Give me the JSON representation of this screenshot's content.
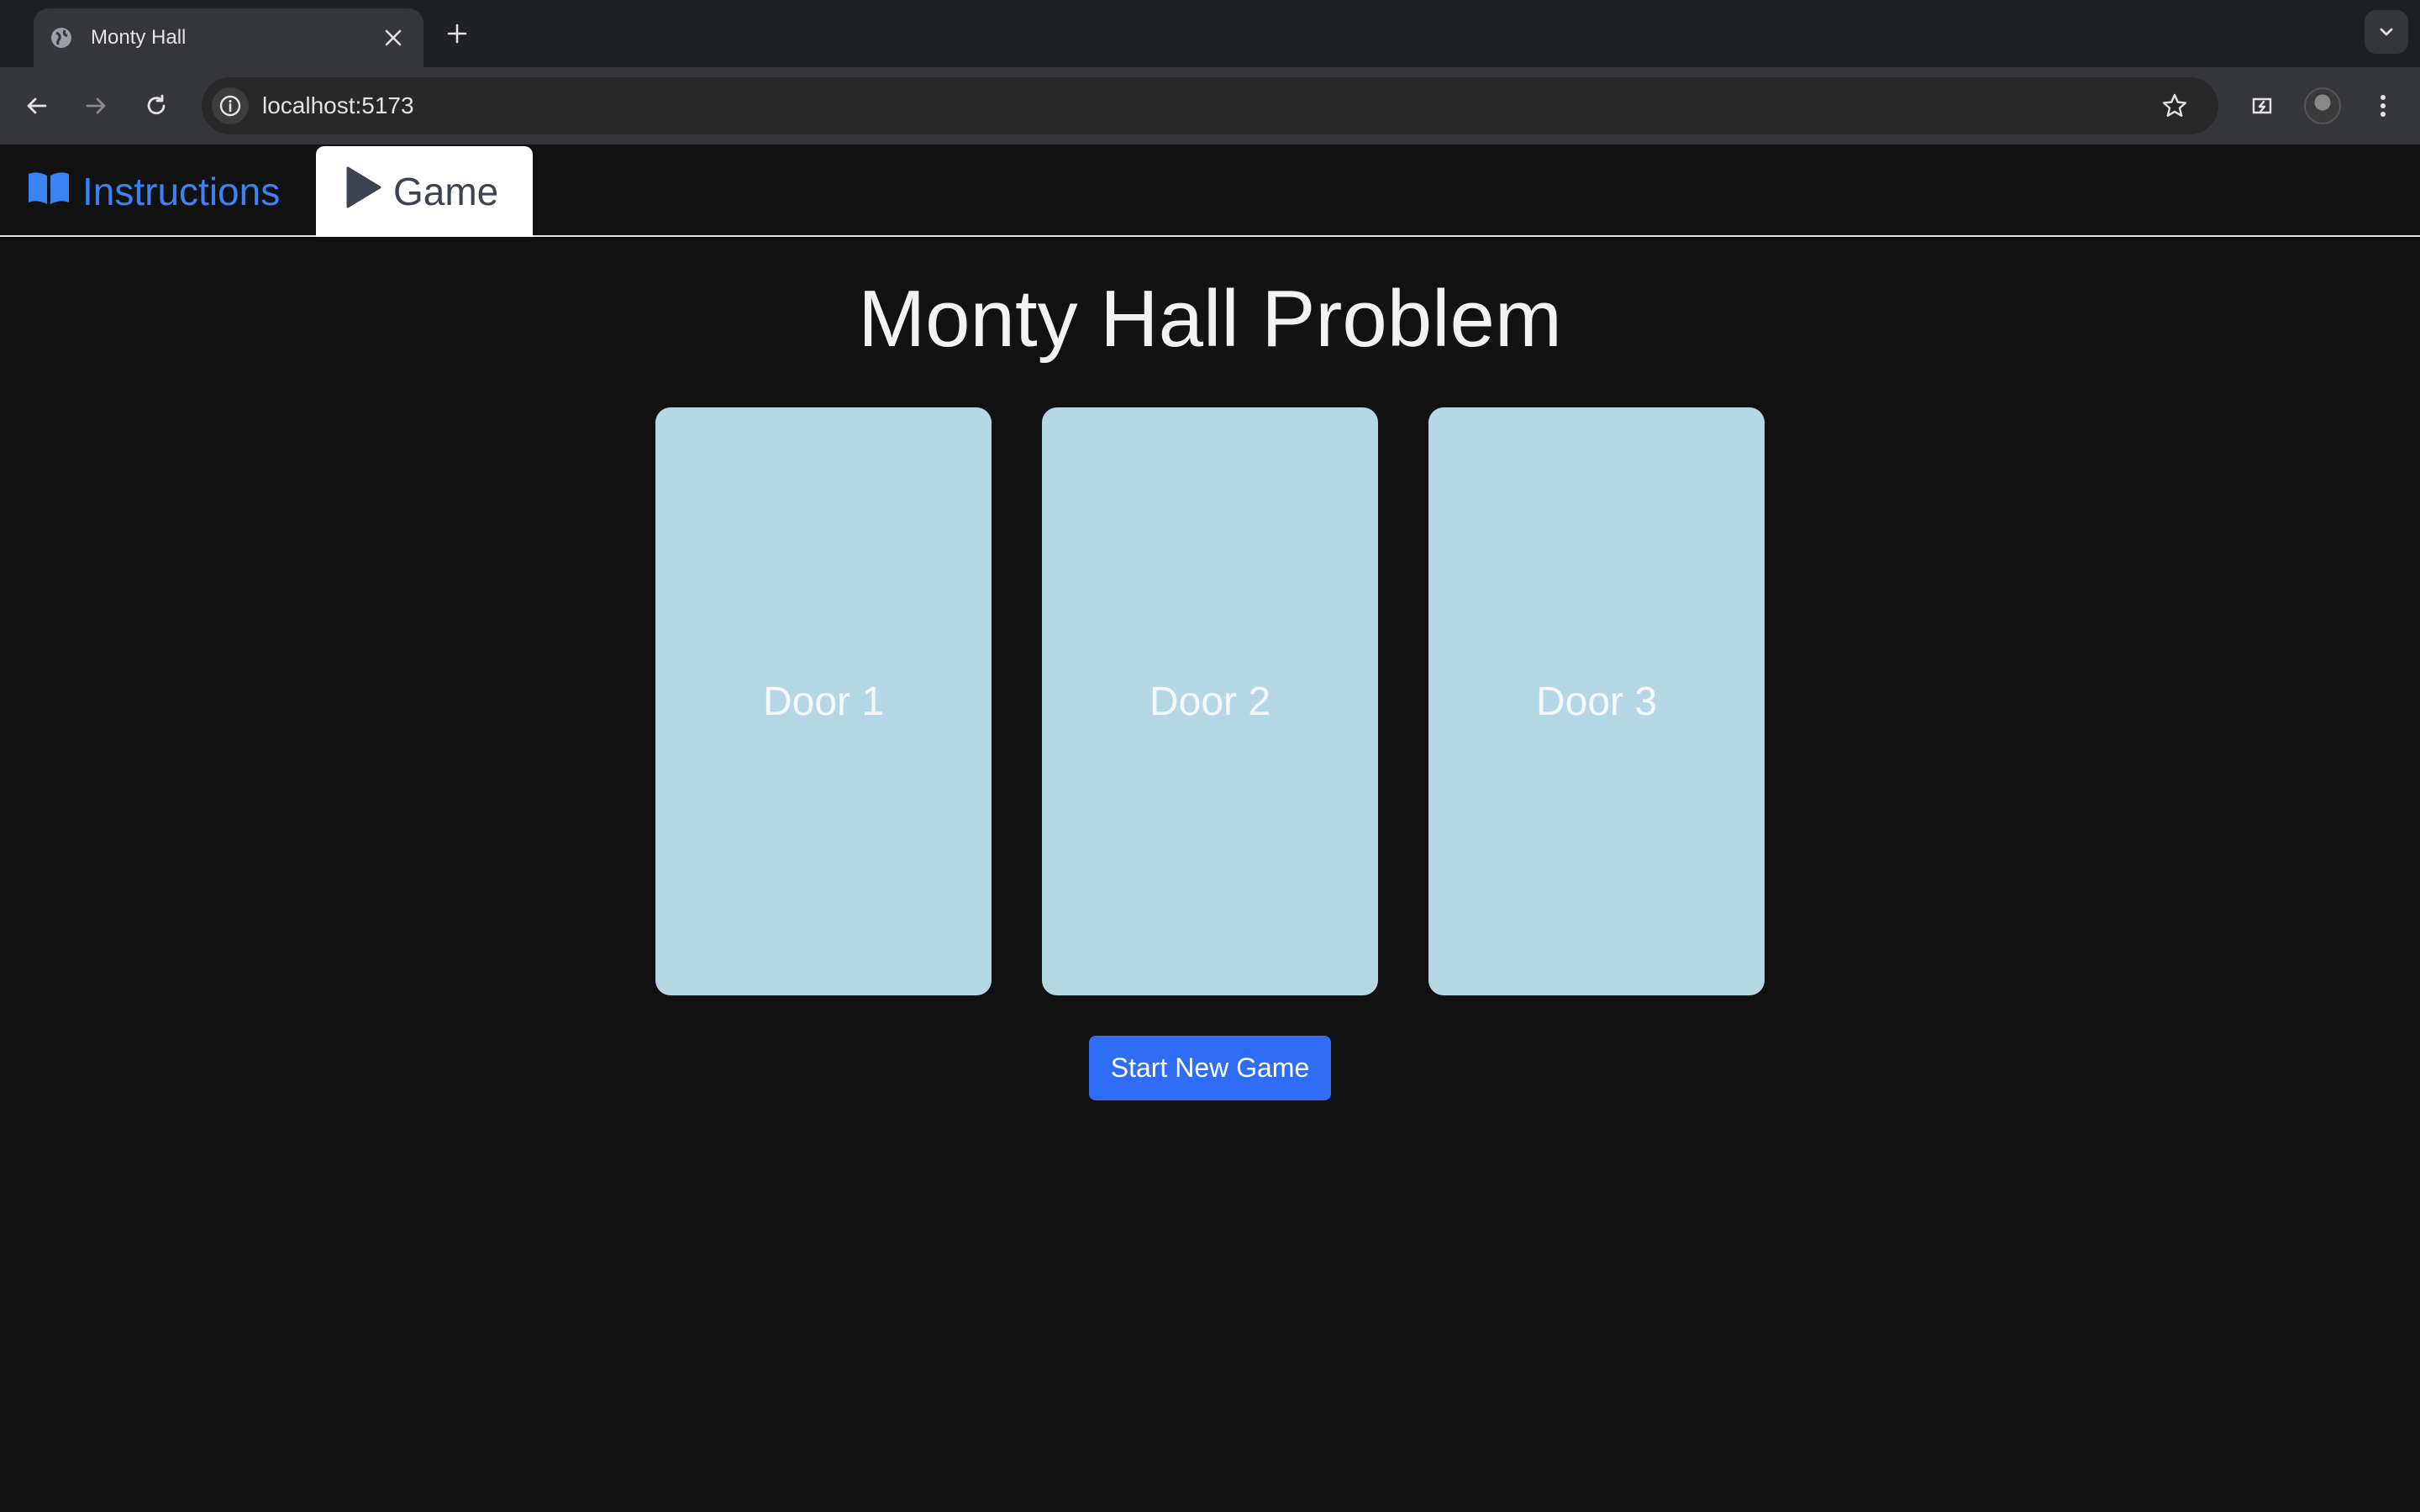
{
  "browser": {
    "tab_title": "Monty Hall",
    "url": "localhost:5173",
    "icons": {
      "favicon": "globe-icon",
      "close": "close-icon",
      "new_tab": "plus-icon",
      "tab_search": "chevron-down-icon",
      "back": "back-arrow-icon",
      "forward": "forward-arrow-icon",
      "reload": "reload-icon",
      "site_info": "info-icon",
      "bookmark": "star-icon",
      "extension": "extension-icon",
      "profile": "avatar",
      "menu": "kebab-menu-icon"
    }
  },
  "nav": {
    "tabs": [
      {
        "label": "Instructions",
        "icon": "book-icon",
        "active": false,
        "color": "#3b82f6"
      },
      {
        "label": "Game",
        "icon": "play-icon",
        "active": true,
        "color": "#3d4451"
      }
    ]
  },
  "main": {
    "title": "Monty Hall Problem",
    "doors": [
      {
        "label": "Door 1"
      },
      {
        "label": "Door 2"
      },
      {
        "label": "Door 3"
      }
    ],
    "start_button": "Start New Game"
  },
  "colors": {
    "background": "#121212",
    "door": "#b4d7e3",
    "button": "#2f6df6",
    "accent": "#3b82f6"
  }
}
